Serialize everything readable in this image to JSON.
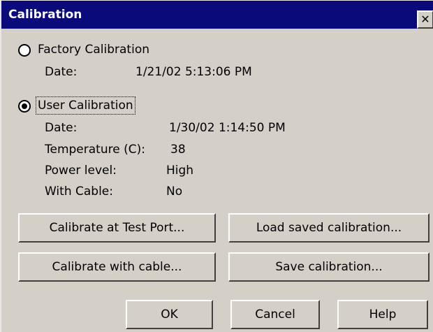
{
  "window": {
    "title": "Calibration",
    "close_glyph": "✕"
  },
  "factory": {
    "label": "Factory Calibration",
    "selected": false,
    "date_label": "Date:",
    "date_value": "1/21/02 5:13:06 PM"
  },
  "user": {
    "label": "User Calibration",
    "selected": true,
    "date_label": "Date:",
    "date_value": "1/30/02 1:14:50 PM",
    "temperature_label": "Temperature (C):",
    "temperature_value": "38",
    "power_label": "Power level:",
    "power_value": "High",
    "cable_label": "With Cable:",
    "cable_value": "No"
  },
  "buttons": {
    "calibrate_test_port": "Calibrate at Test Port...",
    "load_saved": "Load saved calibration...",
    "calibrate_cable": "Calibrate with cable...",
    "save_calibration": "Save calibration...",
    "ok": "OK",
    "cancel": "Cancel",
    "help": "Help"
  },
  "colors": {
    "titlebar": "#0a0a7a",
    "dialog_bg": "#d4d0c8"
  },
  "icons": {
    "close": "close-icon"
  }
}
